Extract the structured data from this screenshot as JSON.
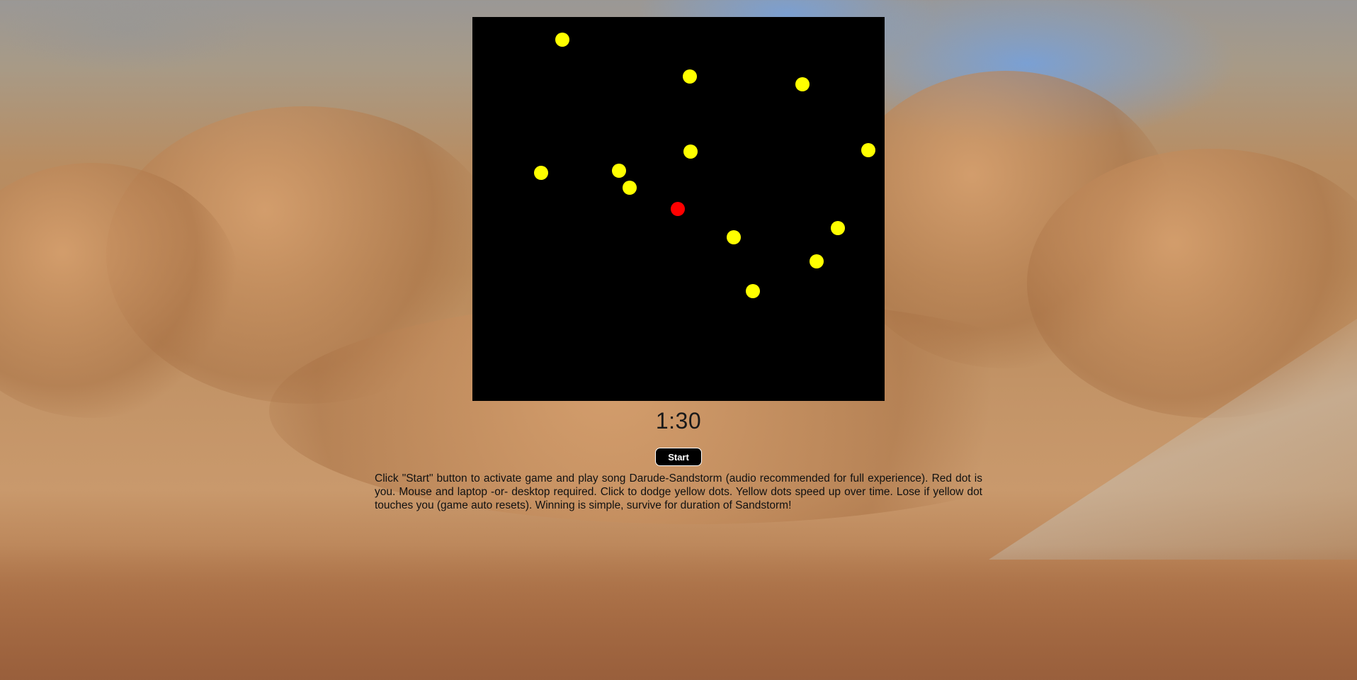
{
  "game": {
    "dot_colors": {
      "enemy": "#ffff00",
      "player": "#ff0000",
      "canvas_bg": "#000000"
    },
    "timer": "1:30",
    "start_label": "Start",
    "instructions": "Click \"Start\" button to activate game and play song Darude-Sandstorm (audio recommended for full experience). Red dot is you. Mouse and laptop -or- desktop required. Click to dodge yellow dots. Yellow dots speed up over time. Lose if yellow dot touches you (game auto resets). Winning is simple, survive for duration of Sandstorm!"
  }
}
